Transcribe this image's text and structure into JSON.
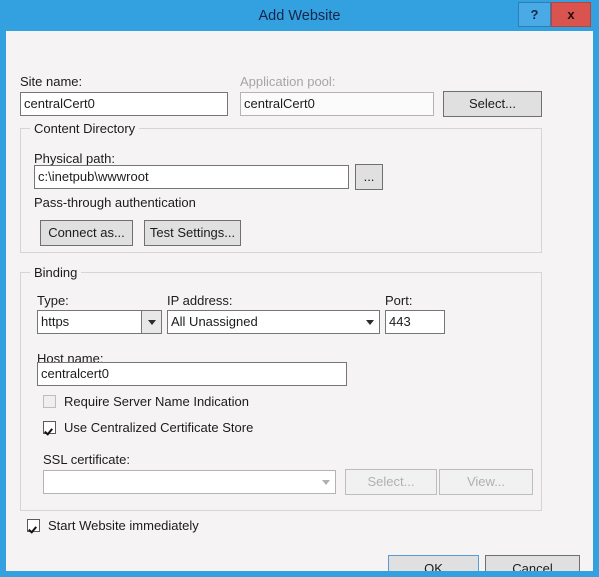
{
  "window": {
    "title": "Add Website",
    "accent_color": "#33a0e0",
    "close_color": "#d9534f",
    "help_button_label": "?",
    "close_button_label": "x"
  },
  "form": {
    "site_name": {
      "label": "Site name:",
      "value": "centralCert0",
      "placeholder": ""
    },
    "application_pool": {
      "label": "Application pool:",
      "value": "centralCert0",
      "placeholder": "",
      "select_button": "Select..."
    }
  },
  "content_directory": {
    "group_title": "Content Directory",
    "physical_path": {
      "label": "Physical path:",
      "value": "c:\\inetpub\\wwwroot",
      "placeholder": "",
      "browse_button": "..."
    },
    "passthrough_label": "Pass-through authentication",
    "connect_as_button": "Connect as...",
    "test_settings_button": "Test Settings..."
  },
  "binding": {
    "group_title": "Binding",
    "type": {
      "label": "Type:",
      "value": "https",
      "options": [
        "http",
        "https"
      ]
    },
    "ip_address": {
      "label": "IP address:",
      "value": "All Unassigned",
      "options": [
        "All Unassigned"
      ]
    },
    "port": {
      "label": "Port:",
      "value": "443",
      "placeholder": ""
    },
    "host_name": {
      "label": "Host name:",
      "value": "centralcert0",
      "placeholder": ""
    },
    "require_sni": {
      "label": "Require Server Name Indication",
      "checked": false,
      "enabled": false
    },
    "use_central_cert_store": {
      "label": "Use Centralized Certificate Store",
      "checked": true,
      "enabled": true
    },
    "ssl_certificate": {
      "label": "SSL certificate:",
      "value": "",
      "placeholder": "",
      "enabled": false,
      "select_button": "Select...",
      "view_button": "View..."
    }
  },
  "footer": {
    "start_website": {
      "label": "Start Website immediately",
      "checked": true
    },
    "ok_button": "OK",
    "cancel_button": "Cancel"
  }
}
